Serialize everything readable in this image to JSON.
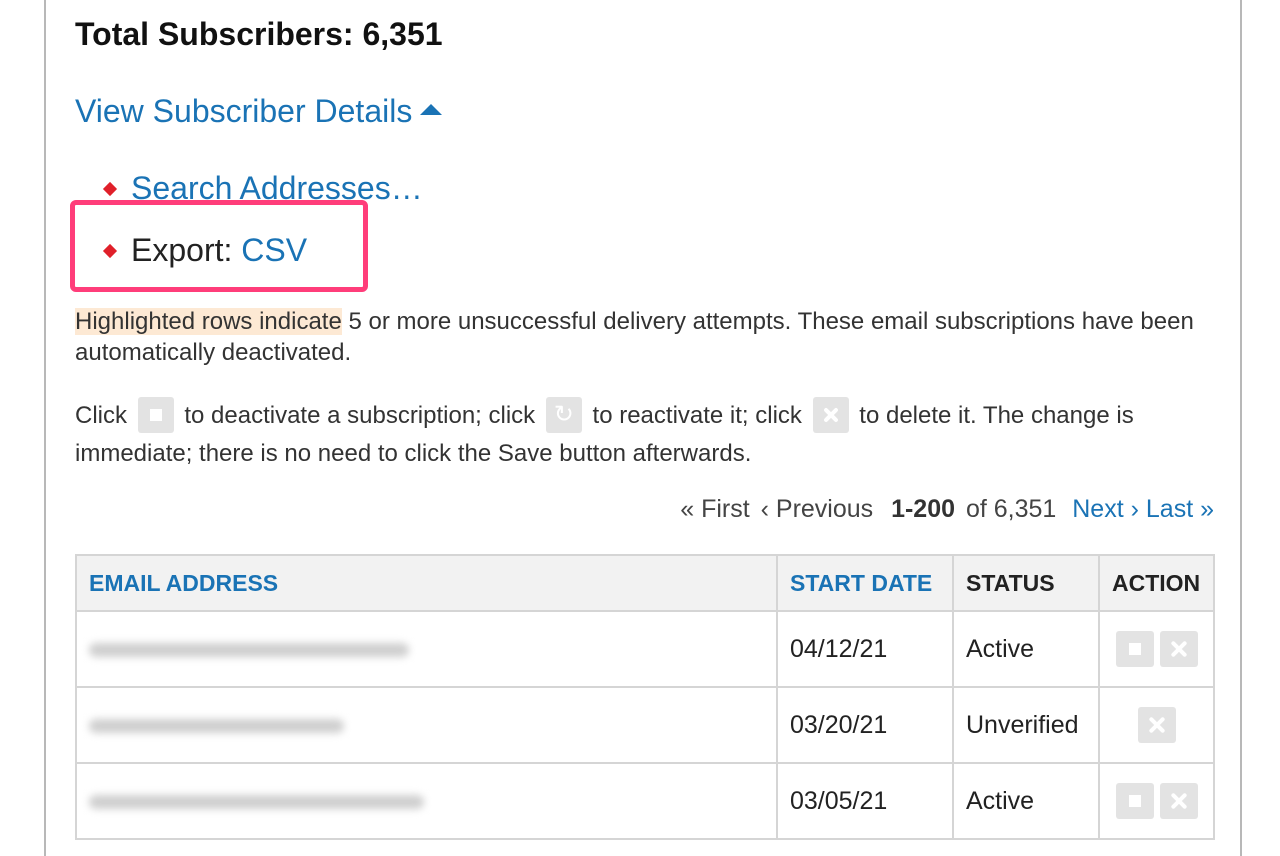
{
  "summary": {
    "total_label": "Total Subscribers: 6,351",
    "details_link": "View Subscriber Details"
  },
  "actions": {
    "search_link": "Search Addresses…",
    "export_label": "Export:",
    "export_csv": "CSV"
  },
  "notes": {
    "highlight_prefix": "Highlighted rows indicate",
    "highlight_rest": " 5 or more unsuccessful delivery attempts. These email subscriptions have been automatically deactivated.",
    "click_1": "Click",
    "click_2": "to deactivate a subscription; click",
    "click_3": "to reactivate it; click",
    "click_4": "to delete it. The change is immediate; there is no need to click the Save button afterwards."
  },
  "pager": {
    "first": "« First",
    "previous": "‹ Previous",
    "range": "1-200",
    "of_total": "of 6,351",
    "next": "Next ›",
    "last": "Last »"
  },
  "table": {
    "headers": {
      "email": "EMAIL ADDRESS",
      "start_date": "START DATE",
      "status": "STATUS",
      "action": "ACTION"
    },
    "rows": [
      {
        "start_date": "04/12/21",
        "status": "Active"
      },
      {
        "start_date": "03/20/21",
        "status": "Unverified"
      },
      {
        "start_date": "03/05/21",
        "status": "Active"
      }
    ]
  },
  "icons": {
    "caret": "caret-up-icon",
    "bullet": "diamond-bullet-icon",
    "deactivate": "square-stop-icon",
    "reactivate": "refresh-icon",
    "delete": "close-x-icon"
  },
  "colors": {
    "link": "#1a73b5",
    "bullet": "#e0202a",
    "annotation_box": "#ff3d7a",
    "highlight": "#fde9d4"
  }
}
